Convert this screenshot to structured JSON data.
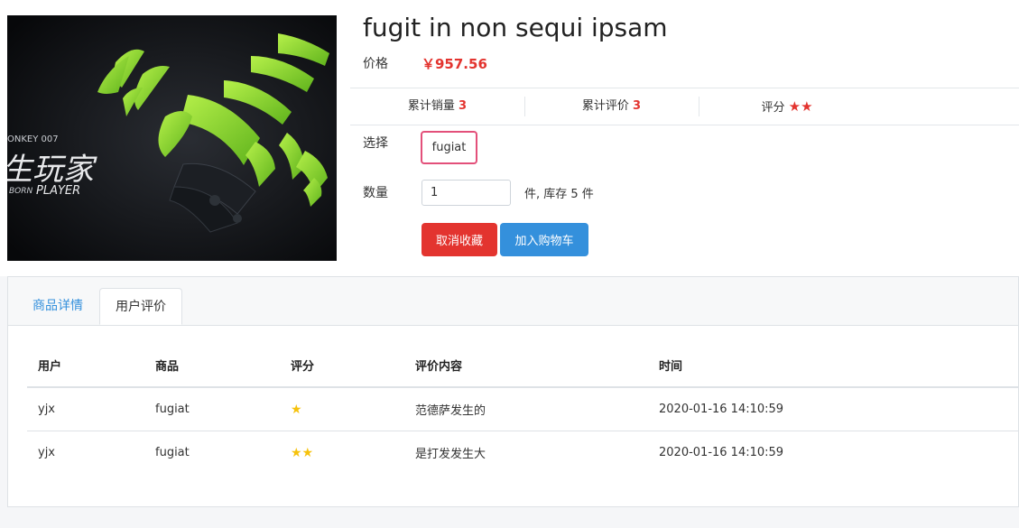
{
  "product": {
    "title": "fugit in non sequi ipsam",
    "price_label": "价格",
    "price": "￥957.56",
    "image_alt": "product-image",
    "image_text": {
      "line1": "ONKEY 007",
      "line2": "生玩家",
      "line3a": "BORN",
      "line3b": "PLAYER"
    }
  },
  "stats": {
    "sales_label": "累计销量",
    "sales_value": "3",
    "reviews_label": "累计评价",
    "reviews_value": "3",
    "rating_label": "评分",
    "rating_stars": "★★"
  },
  "purchase": {
    "select_label": "选择",
    "sku": "fugiat",
    "quantity_label": "数量",
    "quantity_value": "1",
    "stock_text": "件, 库存 5 件",
    "unfavorite_button": "取消收藏",
    "add_to_cart_button": "加入购物车"
  },
  "tabs": [
    {
      "label": "商品详情",
      "active": false
    },
    {
      "label": "用户评价",
      "active": true
    }
  ],
  "reviews_table": {
    "headers": [
      "用户",
      "商品",
      "评分",
      "评价内容",
      "时间"
    ],
    "rows": [
      {
        "user": "yjx",
        "product": "fugiat",
        "rating": 1,
        "stars": "★",
        "content": "范德萨发生的",
        "time": "2020-01-16 14:10:59"
      },
      {
        "user": "yjx",
        "product": "fugiat",
        "rating": 2,
        "stars": "★★",
        "content": "是打发发生大",
        "time": "2020-01-16 14:10:59"
      }
    ]
  },
  "colors": {
    "accent_red": "#e3342f",
    "primary_blue": "#3490dc",
    "star_yellow": "#f6c20c",
    "sku_border": "#e3507a"
  }
}
